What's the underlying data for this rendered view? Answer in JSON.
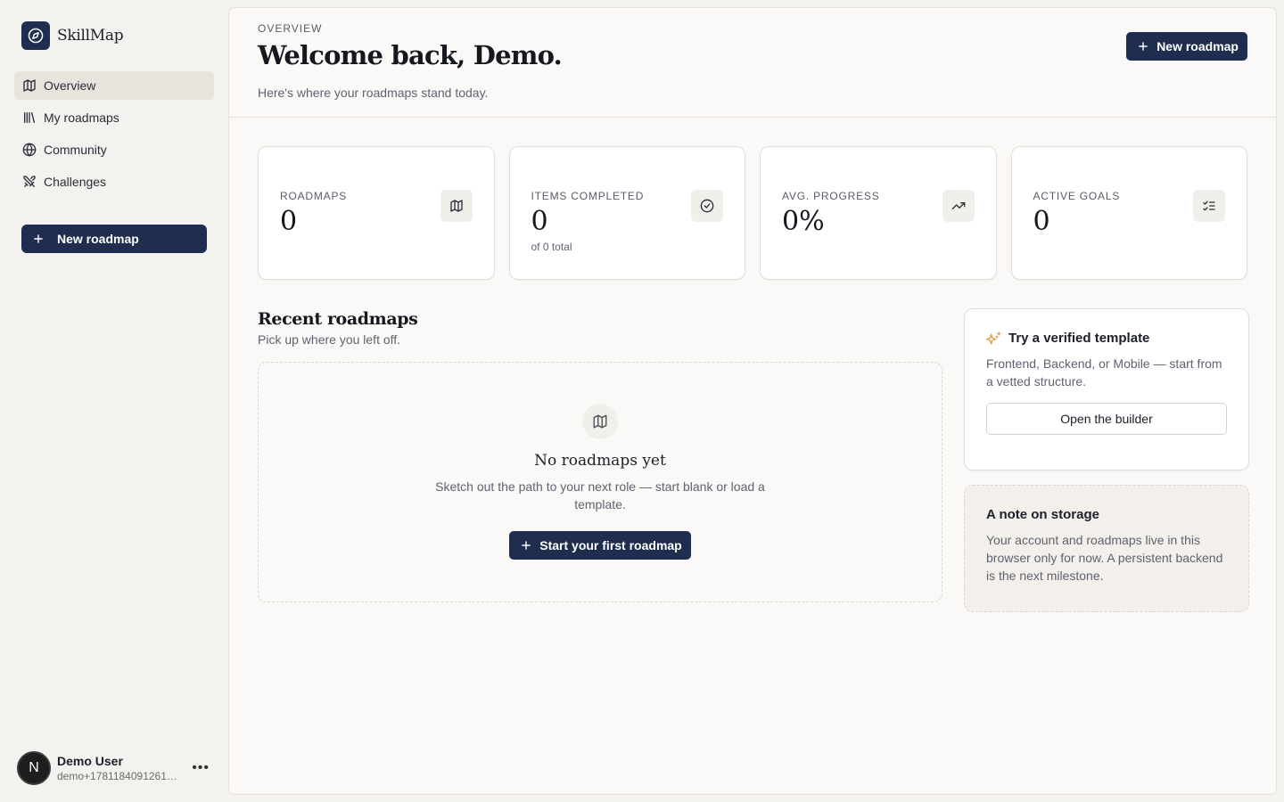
{
  "app": {
    "name": "SkillMap"
  },
  "sidebar": {
    "items": [
      {
        "label": "Overview",
        "icon": "map-icon",
        "active": true
      },
      {
        "label": "My roadmaps",
        "icon": "library-icon"
      },
      {
        "label": "Community",
        "icon": "globe-icon"
      },
      {
        "label": "Challenges",
        "icon": "swords-icon"
      }
    ],
    "new_button": "New roadmap"
  },
  "user": {
    "initial": "N",
    "name": "Demo User",
    "email": "demo+1781184091261@s..."
  },
  "header": {
    "eyebrow": "OVERVIEW",
    "title": "Welcome back, Demo.",
    "subtitle": "Here's where your roadmaps stand today.",
    "new_button": "New roadmap"
  },
  "stats": [
    {
      "label": "ROADMAPS",
      "value": "0",
      "sub": "",
      "icon": "map-icon"
    },
    {
      "label": "ITEMS COMPLETED",
      "value": "0",
      "sub": "of 0 total",
      "icon": "check-circle-icon"
    },
    {
      "label": "AVG. PROGRESS",
      "value": "0%",
      "sub": "",
      "icon": "trending-up-icon"
    },
    {
      "label": "ACTIVE GOALS",
      "value": "0",
      "sub": "",
      "icon": "list-checks-icon"
    }
  ],
  "recent": {
    "title": "Recent roadmaps",
    "subtitle": "Pick up where you left off.",
    "empty_title": "No roadmaps yet",
    "empty_desc": "Sketch out the path to your next role — start blank or load a template.",
    "empty_button": "Start your first roadmap"
  },
  "template_card": {
    "title": "Try a verified template",
    "body": "Frontend, Backend, or Mobile — start from a vetted structure.",
    "button": "Open the builder",
    "icon": "sparkles-icon",
    "icon_color": "#d9a25a"
  },
  "storage_card": {
    "title": "A note on storage",
    "body": "Your account and roadmaps live in this browser only for now. A persistent backend is the next milestone."
  },
  "colors": {
    "accent": "#1f2d4f",
    "background": "#f4f2ee",
    "surface": "#faf9f7"
  }
}
